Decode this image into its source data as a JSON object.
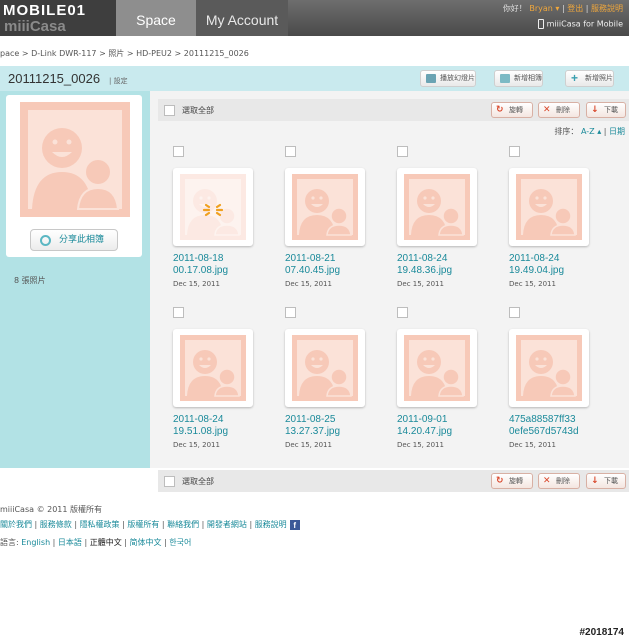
{
  "topbar": {
    "logo_text": "MOBILE01",
    "logo_sub": "miiiCasa",
    "tab_space": "Space",
    "tab_account": "My Account",
    "greeting": "你好！",
    "user_name": "Bryan",
    "logout": "登出",
    "help": "服務說明",
    "mobile_link": "miiiCasa for Mobile"
  },
  "breadcrumb": "pace > D-Link DWR-117 > 照片 > HD-PEU2 > 20111215_0026",
  "album": {
    "title": "20111215_0026",
    "settings": "設定",
    "slideshow_label": "播放幻燈片",
    "new_album_label": "新增相簿",
    "new_photo_label": "新增照片"
  },
  "sidebar": {
    "share_label": "分享此相簿",
    "photo_count": "8 張照片"
  },
  "actions": {
    "select_all": "選取全部",
    "rotate": "旋轉",
    "delete": "刪除",
    "download": "下載"
  },
  "sort": {
    "label": "排序：",
    "az": "A-Z",
    "date": "日期"
  },
  "photos": [
    {
      "line1": "2011-08-18",
      "line2": "00.17.08.jpg",
      "date": "Dec 15, 2011",
      "loading": true
    },
    {
      "line1": "2011-08-21",
      "line2": "07.40.45.jpg",
      "date": "Dec 15, 2011",
      "loading": false
    },
    {
      "line1": "2011-08-24",
      "line2": "19.48.36.jpg",
      "date": "Dec 15, 2011",
      "loading": false
    },
    {
      "line1": "2011-08-24",
      "line2": "19.49.04.jpg",
      "date": "Dec 15, 2011",
      "loading": false
    },
    {
      "line1": "2011-08-24",
      "line2": "19.51.08.jpg",
      "date": "Dec 15, 2011",
      "loading": false
    },
    {
      "line1": "2011-08-25",
      "line2": "13.27.37.jpg",
      "date": "Dec 15, 2011",
      "loading": false
    },
    {
      "line1": "2011-09-01",
      "line2": "14.20.47.jpg",
      "date": "Dec 15, 2011",
      "loading": false
    },
    {
      "line1": "475a88587ff33",
      "line2": "0efe567d5743d",
      "date": "Dec 15, 2011",
      "loading": false
    }
  ],
  "footer": {
    "copyright": "miiiCasa © 2011   版權所有",
    "links": [
      "關於我們",
      "服務條款",
      "隱私權政策",
      "版權所有",
      "聯絡我們",
      "開發者網站",
      "服務說明"
    ],
    "lang_label": "語言:",
    "languages": [
      "English",
      "日本語",
      "正體中文",
      "简体中文",
      "한국어"
    ],
    "current_language": "正體中文"
  },
  "watermark": "#2018174",
  "colors": {
    "accent": "#1a8a9a",
    "sidebar_bg": "#b2e2e5",
    "placeholder": "#f7c9b8",
    "action_icon": "#d9472b"
  }
}
